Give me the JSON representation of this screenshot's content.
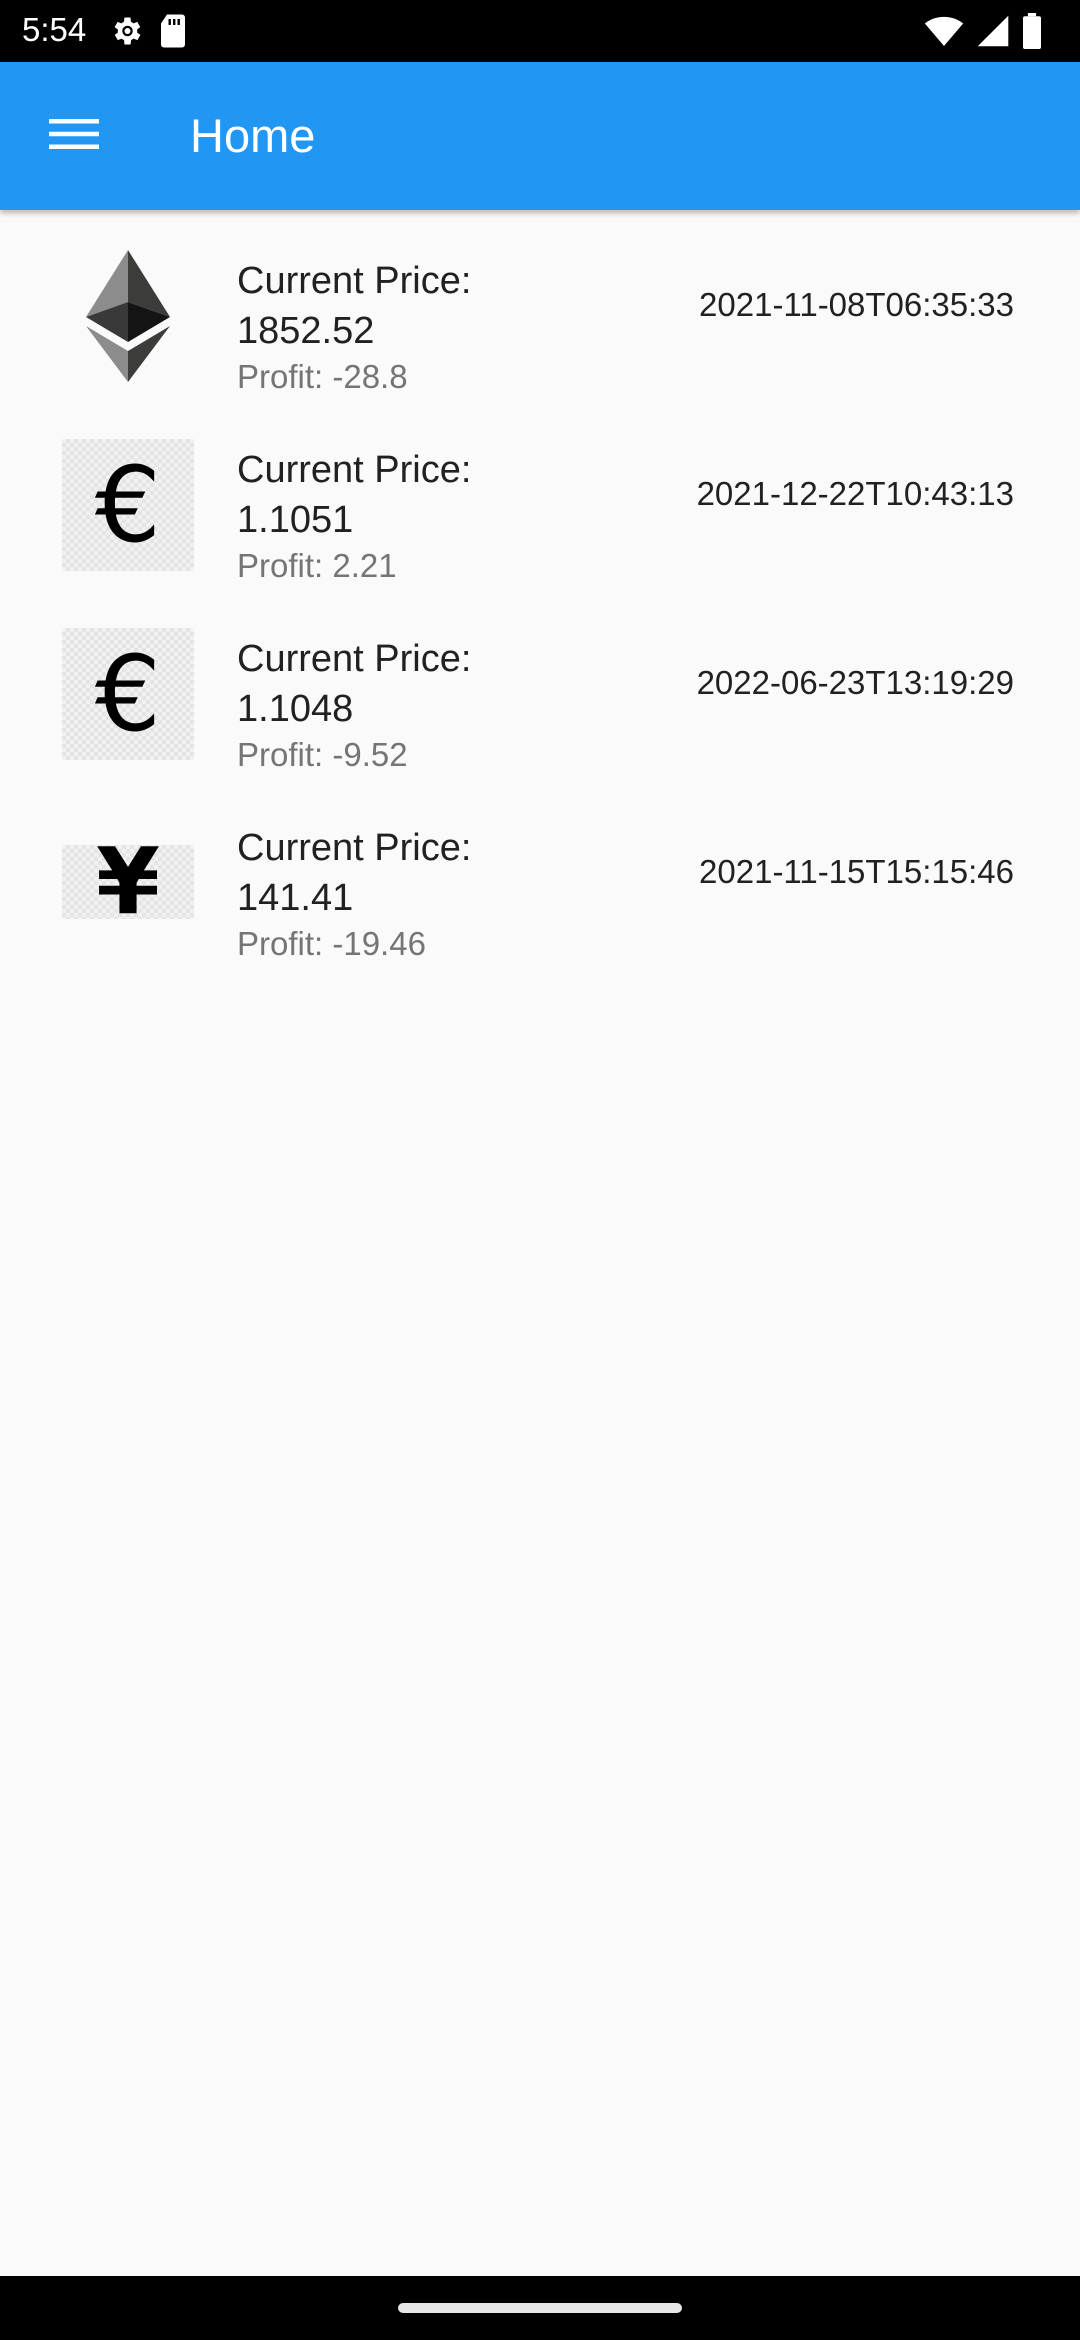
{
  "status_bar": {
    "time": "5:54",
    "left_icons": [
      "settings-icon",
      "sd-card-icon"
    ],
    "right_icons": [
      "wifi-icon",
      "signal-icon",
      "battery-icon"
    ]
  },
  "app_bar": {
    "title": "Home",
    "menu_icon": "hamburger-menu-icon",
    "background_color": "#2196f3"
  },
  "items": [
    {
      "icon": "ethereum-icon",
      "price_label": "Current Price:",
      "price": "1852.52",
      "profit": "Profit: -28.8",
      "date": "2021-11-08T06:35:33"
    },
    {
      "icon": "euro-icon",
      "glyph": "€",
      "price_label": "Current Price:",
      "price": "1.1051",
      "profit": "Profit: 2.21",
      "date": "2021-12-22T10:43:13"
    },
    {
      "icon": "euro-icon",
      "glyph": "€",
      "price_label": "Current Price:",
      "price": "1.1048",
      "profit": "Profit: -9.52",
      "date": "2022-06-23T13:19:29"
    },
    {
      "icon": "yen-icon",
      "glyph": "¥",
      "price_label": "Current Price:",
      "price": "141.41",
      "profit": "Profit: -19.46",
      "date": "2021-11-15T15:15:46"
    }
  ]
}
